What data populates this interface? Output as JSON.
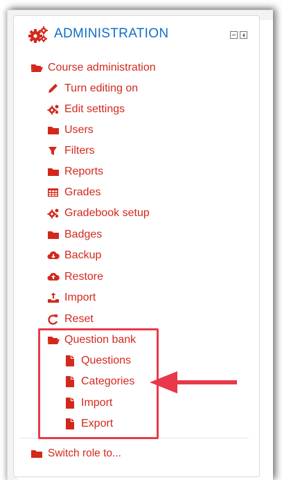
{
  "block": {
    "title": "ADMINISTRATION",
    "icon": "gears-icon",
    "controls": [
      "dock-minimize-icon",
      "dock-collapse-icon"
    ]
  },
  "tree": {
    "root": {
      "label": "Course administration",
      "icon": "folder-open-icon"
    },
    "items": [
      {
        "label": "Turn editing on",
        "icon": "pencil-icon"
      },
      {
        "label": "Edit settings",
        "icon": "gears-icon"
      },
      {
        "label": "Users",
        "icon": "folder-icon"
      },
      {
        "label": "Filters",
        "icon": "filter-icon"
      },
      {
        "label": "Reports",
        "icon": "folder-icon"
      },
      {
        "label": "Grades",
        "icon": "table-icon"
      },
      {
        "label": "Gradebook setup",
        "icon": "gears-icon"
      },
      {
        "label": "Badges",
        "icon": "folder-icon"
      },
      {
        "label": "Backup",
        "icon": "cloud-download-icon"
      },
      {
        "label": "Restore",
        "icon": "cloud-upload-icon"
      },
      {
        "label": "Import",
        "icon": "upload-icon"
      },
      {
        "label": "Reset",
        "icon": "refresh-icon"
      }
    ],
    "question_bank": {
      "label": "Question bank",
      "icon": "folder-open-icon",
      "children": [
        {
          "label": "Questions",
          "icon": "file-icon"
        },
        {
          "label": "Categories",
          "icon": "file-icon"
        },
        {
          "label": "Import",
          "icon": "file-icon"
        },
        {
          "label": "Export",
          "icon": "file-icon"
        }
      ]
    },
    "switch_role": {
      "label": "Switch role to...",
      "icon": "folder-icon"
    }
  },
  "colors": {
    "link": "#d4281c",
    "title": "#0f6fc5",
    "highlight": "#e8394a"
  }
}
